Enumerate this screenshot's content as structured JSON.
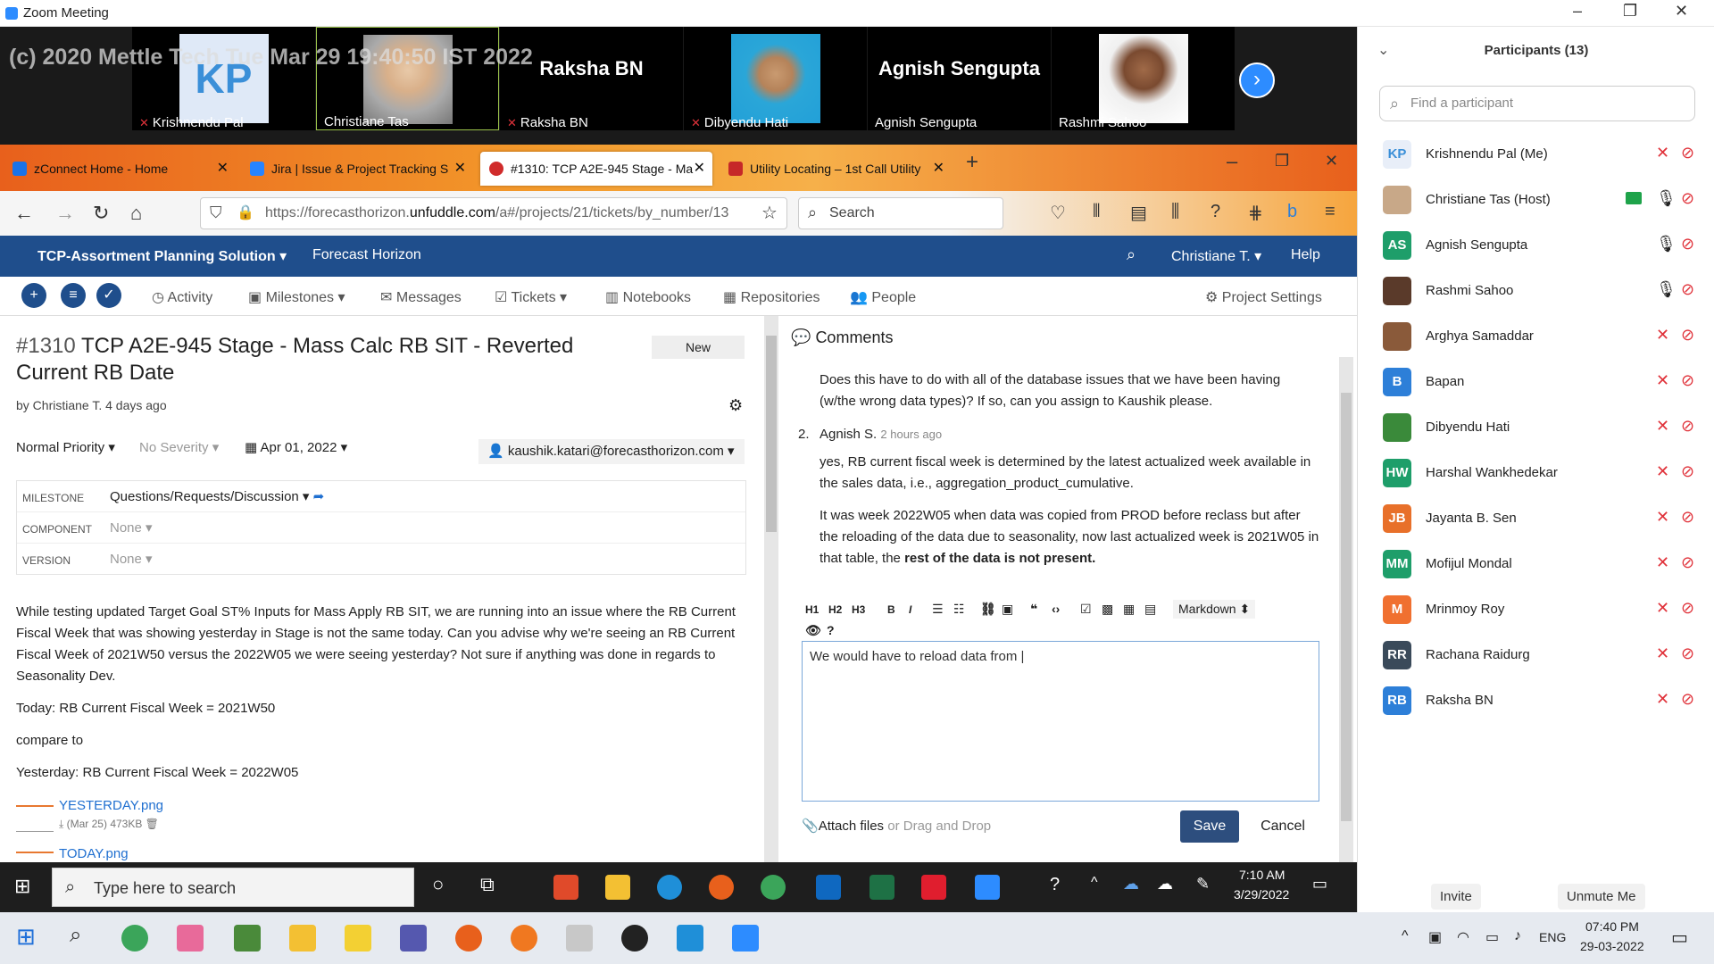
{
  "zoom": {
    "title": "Zoom Meeting",
    "watermark": "(c) 2020 Mettle Tech Tue Mar 29 19:40:50 IST 2022"
  },
  "tiles": [
    {
      "name": "Krishnendu Pal",
      "initials": "KP",
      "muted": true
    },
    {
      "name": "Christiane Tas",
      "muted": false
    },
    {
      "name": "Raksha BN",
      "big": "Raksha BN",
      "muted": true
    },
    {
      "name": "Dibyendu Hati",
      "muted": true
    },
    {
      "name": "Agnish Sengupta",
      "big": "Agnish Sengupta",
      "muted": false
    },
    {
      "name": "Rashmi Sahoo",
      "muted": false
    }
  ],
  "browser": {
    "tabs": [
      {
        "label": "zConnect Home - Home",
        "color": "#1a73e8"
      },
      {
        "label": "Jira | Issue & Project Tracking S",
        "color": "#2684ff"
      },
      {
        "label": "#1310: TCP A2E-945 Stage - Ma",
        "color": "#d02b2b"
      },
      {
        "label": "Utility Locating – 1st Call Utility",
        "color": "#c62828"
      }
    ],
    "url_prefix": "https://forecasthorizon.",
    "url_domain": "unfuddle.com",
    "url_suffix": "/a#/projects/21/tickets/by_number/13",
    "search": "Search"
  },
  "app": {
    "project": "TCP-Assortment Planning Solution ▾",
    "org": "Forecast Horizon",
    "user": "Christiane T. ▾",
    "help": "Help",
    "nav": [
      "Activity",
      "Milestones ▾",
      "Messages",
      "Tickets ▾",
      "Notebooks",
      "Repositories",
      "People"
    ],
    "settings": "Project Settings"
  },
  "ticket": {
    "number": "#1310",
    "title_line1": "TCP A2E-945 Stage - Mass Calc RB SIT - Reverted",
    "title_line2": "Current RB Date",
    "status": "New",
    "byline": "by Christiane T. 4 days ago",
    "priority": "Normal Priority ▾",
    "severity": "No Severity ▾",
    "date": "Apr 01, 2022 ▾",
    "assignee": "kaushik.katari@forecasthorizon.com ▾",
    "milestone_k": "MILESTONE",
    "milestone_v": "Questions/Requests/Discussion ▾",
    "component_k": "COMPONENT",
    "component_v": "None ▾",
    "version_k": "VERSION",
    "version_v": "None ▾",
    "body": "While testing updated Target Goal ST% Inputs for Mass Apply RB SIT, we are running into an issue where the RB Current Fiscal Week that was showing yesterday in Stage is not the same today. Can you advise why we're seeing an RB Current Fiscal Week of 2021W50 versus the 2022W05 we were seeing yesterday? Not sure if anything was done in regards to Seasonality Dev.",
    "today": "Today: RB Current Fiscal Week = 2021W50",
    "compare": "compare to",
    "yesterday": "Yesterday: RB Current Fiscal Week = 2022W05",
    "att1": "YESTERDAY.png",
    "att1_meta": "(Mar 25) 473KB",
    "att2": "TODAY.png"
  },
  "comments": {
    "heading": "Comments",
    "c1": "Does this have to do with all of the database issues that we have been having (w/the wrong data types)? If so, can you assign to Kaushik please.",
    "num2": "2.",
    "author2": "Agnish S.",
    "time2": "2 hours ago",
    "c2a": "yes, RB current fiscal week is determined by the latest actualized week available in the sales data, i.e., aggregation_product_cumulative.",
    "c2b": "It was week 2022W05 when data was copied from PROD before reclass but after the reloading of the data due to seasonality, now last actualized week is 2021W05 in that table, the ",
    "c2b_bold": "rest of the data is not present.",
    "markdown": "Markdown ⬍",
    "draft": "We would have to reload data from |",
    "attach": "Attach files",
    "drag": "or Drag and Drop",
    "save": "Save",
    "cancel": "Cancel"
  },
  "taskbar": {
    "search": "Type here to search",
    "time": "7:10 AM",
    "date": "3/29/2022"
  },
  "participants": {
    "header": "Participants (13)",
    "find": "Find a participant",
    "list": [
      {
        "name": "Krishnendu Pal (Me)",
        "init": "KP",
        "color": "#e8eef8"
      },
      {
        "name": "Christiane Tas (Host)",
        "init": "",
        "color": "#c8a888"
      },
      {
        "name": "Agnish Sengupta",
        "init": "AS",
        "color": "#1e9e6a"
      },
      {
        "name": "Rashmi Sahoo",
        "init": "",
        "color": "#5a3a2a"
      },
      {
        "name": "Arghya Samaddar",
        "init": "",
        "color": "#8a5a3a"
      },
      {
        "name": "Bapan",
        "init": "B",
        "color": "#2d7fd8"
      },
      {
        "name": "Dibyendu Hati",
        "init": "",
        "color": "#3a8a3a"
      },
      {
        "name": "Harshal Wankhedekar",
        "init": "HW",
        "color": "#1e9e6a"
      },
      {
        "name": "Jayanta B. Sen",
        "init": "JB",
        "color": "#e8702a"
      },
      {
        "name": "Mofijul Mondal",
        "init": "MM",
        "color": "#1e9e6a"
      },
      {
        "name": "Mrinmoy Roy",
        "init": "M",
        "color": "#f07030"
      },
      {
        "name": "Rachana Raidurg",
        "init": "RR",
        "color": "#3a4a5a"
      },
      {
        "name": "Raksha BN",
        "init": "RB",
        "color": "#2d7fd8"
      }
    ],
    "invite": "Invite",
    "unmute": "Unmute Me"
  },
  "win": {
    "lang": "ENG",
    "time": "07:40 PM",
    "date": "29-03-2022"
  }
}
